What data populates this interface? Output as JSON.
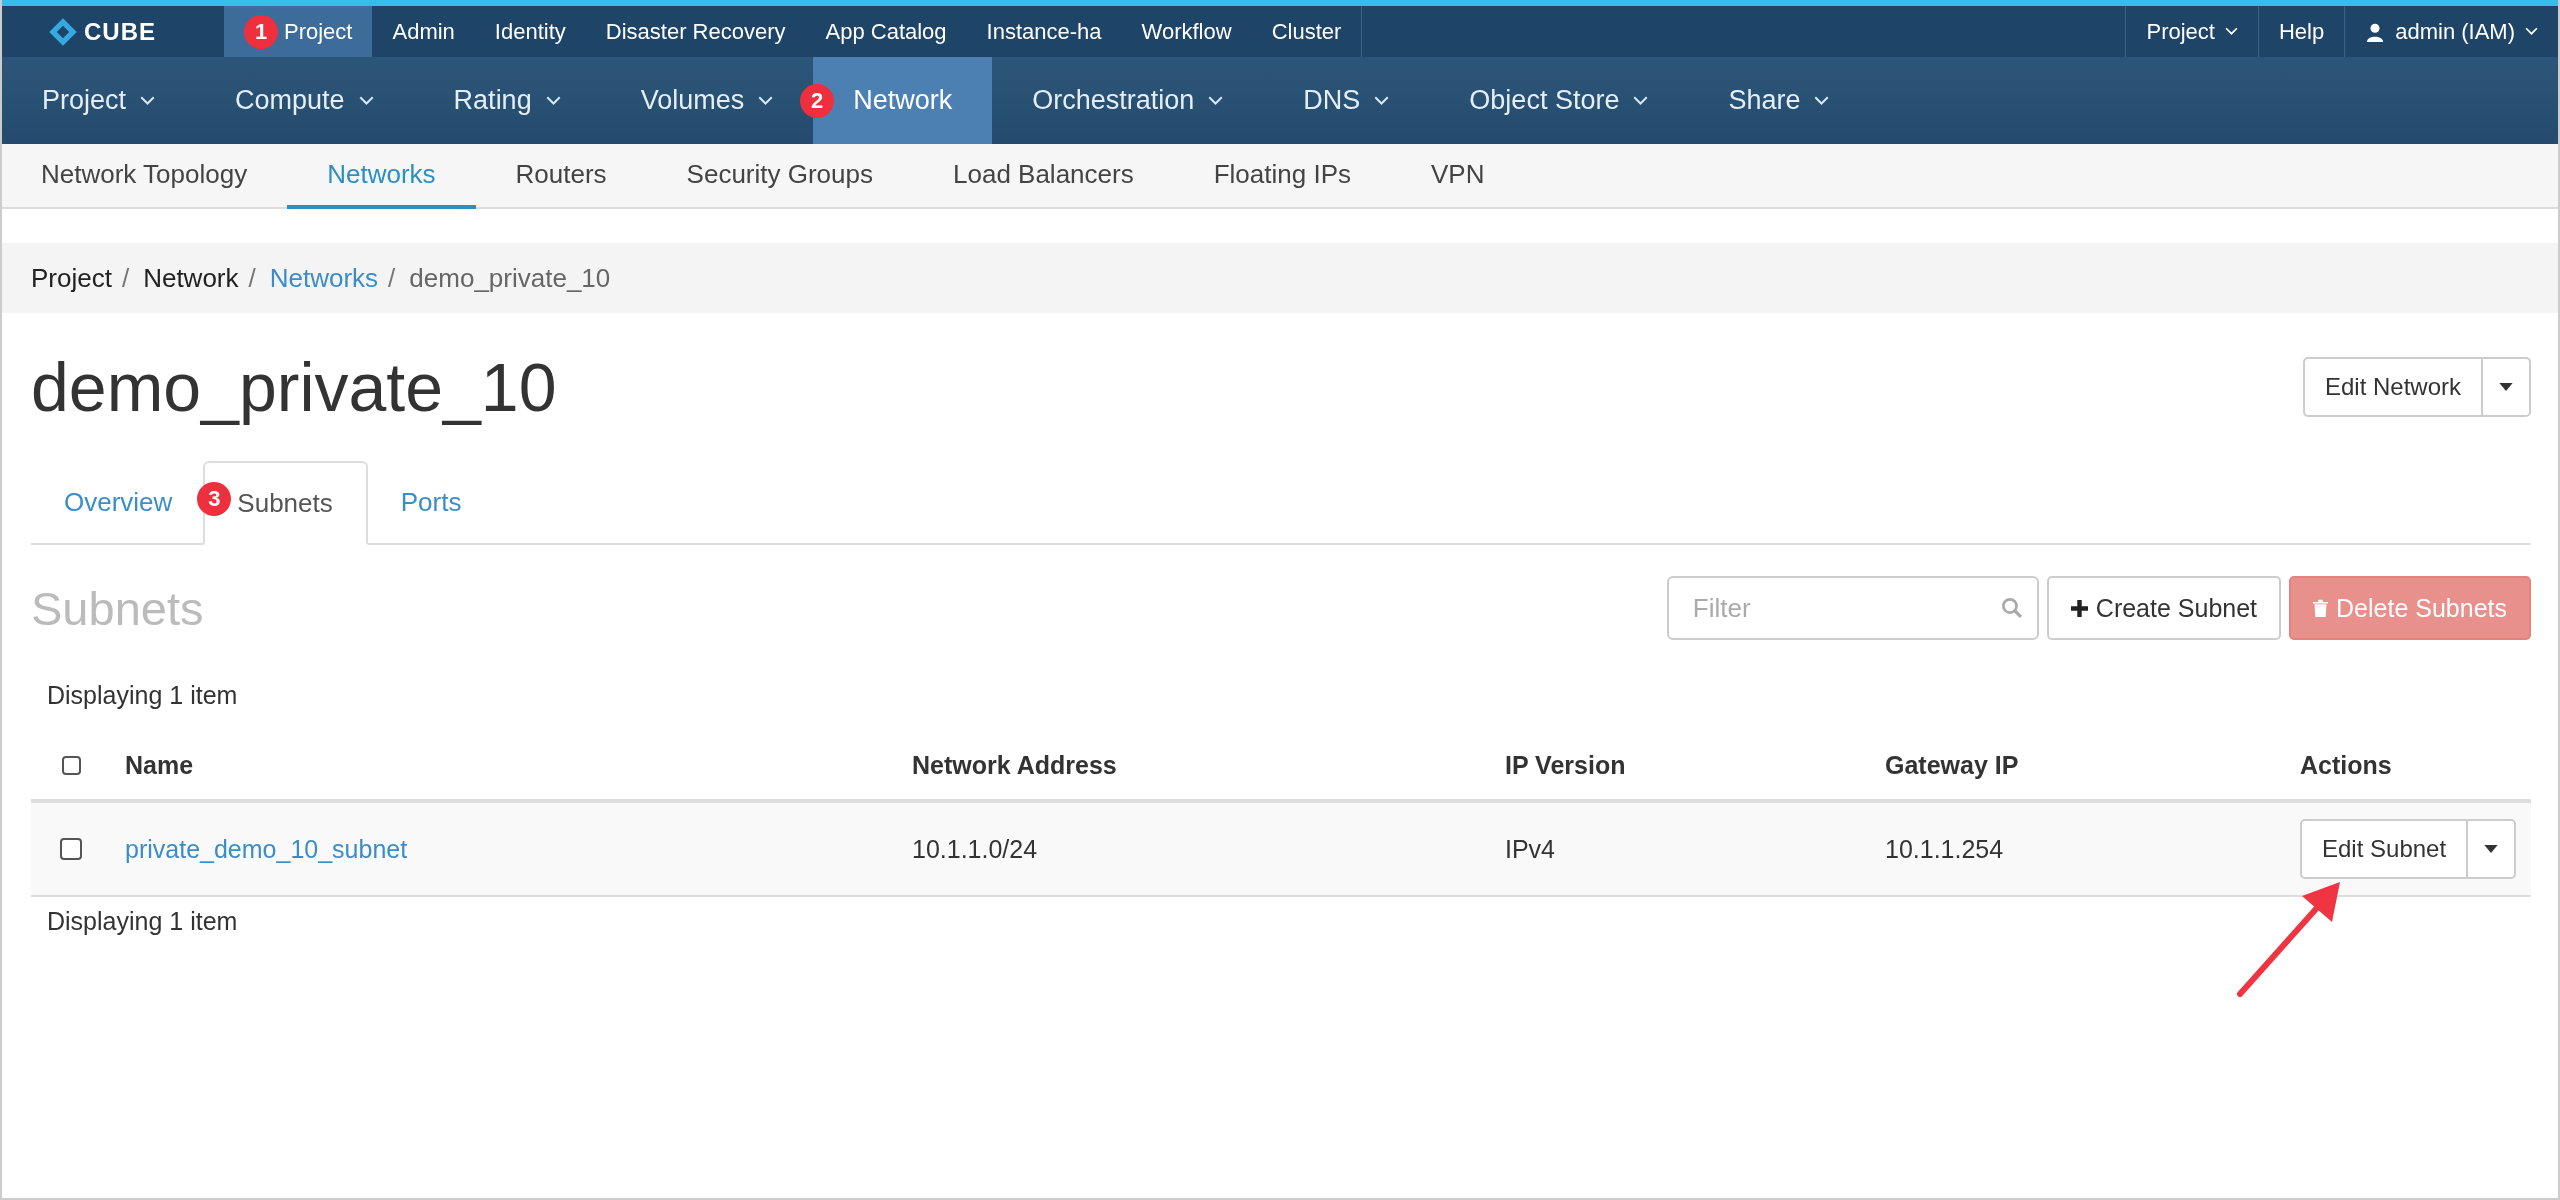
{
  "top_bar": {
    "logo": "CUBE",
    "items": [
      {
        "label": "Project",
        "selected": true,
        "badge": "1"
      },
      {
        "label": "Admin",
        "selected": false
      },
      {
        "label": "Identity",
        "selected": false
      },
      {
        "label": "Disaster Recovery",
        "selected": false
      },
      {
        "label": "App Catalog",
        "selected": false
      },
      {
        "label": "Instance-ha",
        "selected": false
      },
      {
        "label": "Workflow",
        "selected": false
      },
      {
        "label": "Cluster",
        "selected": false
      }
    ],
    "right_items": [
      {
        "label": "Project",
        "kind": "dropdown"
      },
      {
        "label": "Help",
        "kind": "link"
      },
      {
        "label": "admin (IAM)",
        "kind": "user"
      }
    ]
  },
  "main_nav": {
    "items": [
      {
        "label": "Project",
        "selected": false,
        "dropdown": true
      },
      {
        "label": "Compute",
        "selected": false,
        "dropdown": true
      },
      {
        "label": "Rating",
        "selected": false,
        "dropdown": true
      },
      {
        "label": "Volumes",
        "selected": false,
        "dropdown": true
      },
      {
        "label": "Network",
        "selected": true,
        "dropdown": false,
        "badge": "2"
      },
      {
        "label": "Orchestration",
        "selected": false,
        "dropdown": true
      },
      {
        "label": "DNS",
        "selected": false,
        "dropdown": true
      },
      {
        "label": "Object Store",
        "selected": false,
        "dropdown": true
      },
      {
        "label": "Share",
        "selected": false,
        "dropdown": true
      }
    ]
  },
  "sub_nav": {
    "items": [
      {
        "label": "Network Topology",
        "selected": false
      },
      {
        "label": "Networks",
        "selected": true
      },
      {
        "label": "Routers",
        "selected": false
      },
      {
        "label": "Security Groups",
        "selected": false
      },
      {
        "label": "Load Balancers",
        "selected": false
      },
      {
        "label": "Floating IPs",
        "selected": false
      },
      {
        "label": "VPN",
        "selected": false
      }
    ]
  },
  "breadcrumb": [
    {
      "label": "Project",
      "kind": "text",
      "separator": "/"
    },
    {
      "label": "Network",
      "kind": "text",
      "separator": "/"
    },
    {
      "label": "Networks",
      "kind": "link",
      "separator": "/"
    },
    {
      "label": "demo_private_10",
      "kind": "current"
    }
  ],
  "page_title": "demo_private_10",
  "header_action": {
    "label": "Edit Network"
  },
  "tabs": [
    {
      "label": "Overview",
      "selected": false
    },
    {
      "label": "Subnets",
      "selected": true,
      "badge": "3"
    },
    {
      "label": "Ports",
      "selected": false
    }
  ],
  "section_title": "Subnets",
  "filter": {
    "placeholder": "Filter"
  },
  "buttons": [
    {
      "label": "Create Subnet",
      "kind": "create",
      "disabled": false
    },
    {
      "label": "Delete Subnets",
      "kind": "delete",
      "disabled": true
    }
  ],
  "table": {
    "count_top": "Displaying 1 item",
    "select_all": {
      "checked": false
    },
    "columns": [
      "Name",
      "Network Address",
      "IP Version",
      "Gateway IP",
      "Actions"
    ],
    "rows": [
      {
        "checked": false,
        "name": "private_demo_10_subnet",
        "network_address": "10.1.1.0/24",
        "ip_version": "IPv4",
        "gateway_ip": "10.1.1.254",
        "action": "Edit Subnet"
      }
    ],
    "count_bottom": "Displaying 1 item"
  }
}
